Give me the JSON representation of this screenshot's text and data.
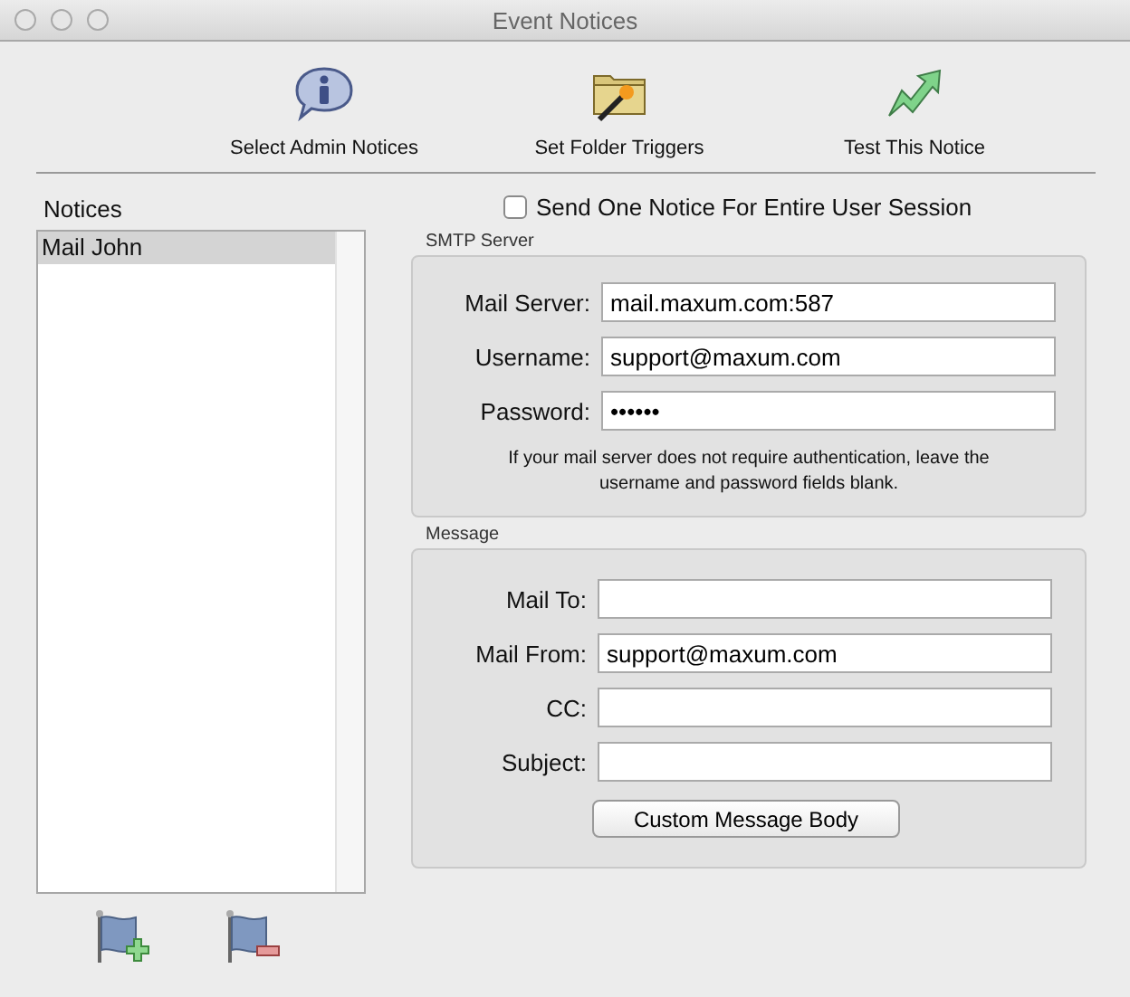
{
  "window": {
    "title": "Event Notices"
  },
  "toolbar": [
    {
      "label": "Select Admin Notices",
      "kind": "info"
    },
    {
      "label": "Set Folder Triggers",
      "kind": "folder"
    },
    {
      "label": "Test This Notice",
      "kind": "arrow"
    }
  ],
  "notices": {
    "label": "Notices",
    "items": [
      {
        "label": "Mail John",
        "selected": true
      }
    ]
  },
  "session_checkbox": {
    "label": "Send One Notice For Entire User Session",
    "checked": false
  },
  "smtp_server": {
    "title": "SMTP Server",
    "fields": [
      {
        "label": "Mail Server:",
        "value": "mail.maxum.com:587"
      },
      {
        "label": "Username:",
        "value": "support@maxum.com"
      },
      {
        "label": "Password:",
        "value": "••••••"
      }
    ],
    "note": "If your mail server does not require authentication, leave the username and password fields blank."
  },
  "message": {
    "title": "Message",
    "fields": [
      {
        "label": "Mail To:"
      },
      {
        "label": "Mail From:",
        "value": "support@maxum.com"
      },
      {
        "label": "CC:"
      },
      {
        "label": "Subject:"
      }
    ],
    "button": "Custom Message Body"
  }
}
